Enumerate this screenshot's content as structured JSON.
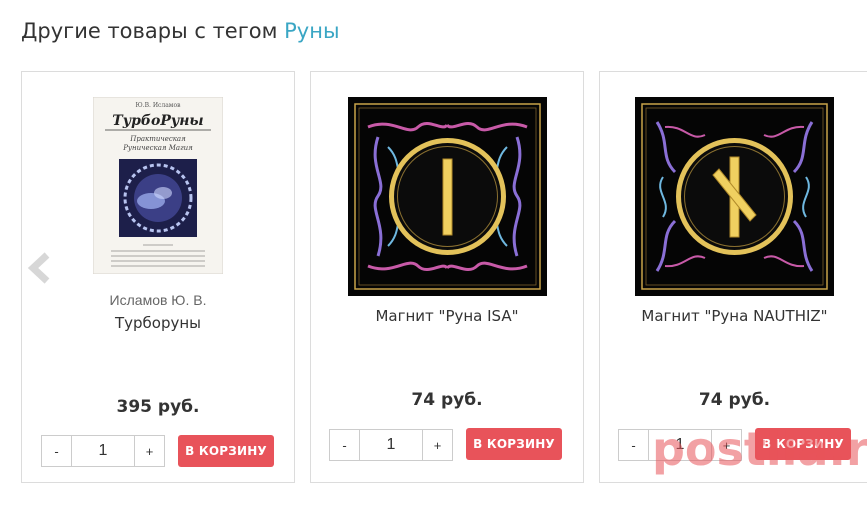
{
  "section": {
    "heading_prefix": "Другие товары с тегом",
    "tag_link": "Руны"
  },
  "colors": {
    "tag_link": "#3aa6c4",
    "cart_button": "#e8535a"
  },
  "products": [
    {
      "author": "Исламов Ю. В.",
      "title": "Турборуны",
      "price": "395 руб.",
      "quantity": "1",
      "minus": "-",
      "plus": "+",
      "cart_label": "В КОРЗИНУ",
      "cover": {
        "author_line": "Ю.В. Исламов",
        "book_title": "ТурбоРуны",
        "subtitle_1": "Практическая",
        "subtitle_2": "Руническая Магия"
      }
    },
    {
      "author": "",
      "title": "Магнит \"Руна ISA\"",
      "price": "74 руб.",
      "quantity": "1",
      "minus": "-",
      "plus": "+",
      "cart_label": "В КОРЗИНУ"
    },
    {
      "author": "",
      "title": "Магнит \"Руна NAUTHIZ\"",
      "price": "74 руб.",
      "quantity": "1",
      "minus": "-",
      "plus": "+",
      "cart_label": "В КОРЗИНУ"
    }
  ],
  "carousel": {
    "prev_icon": "chevron-left-icon"
  },
  "watermark": "postila.ru"
}
